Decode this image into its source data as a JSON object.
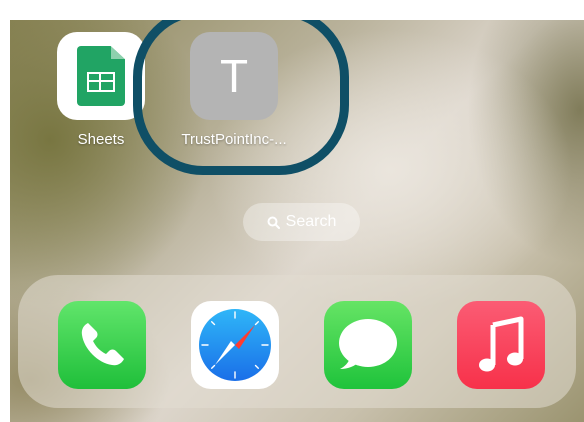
{
  "home_screen": {
    "apps": [
      {
        "label": "Sheets",
        "icon": "google-sheets-icon",
        "color": "#21a464"
      },
      {
        "label": "TrustPointInc-...",
        "icon_letter": "T",
        "icon": "letter-t-icon",
        "color": "#b4b4b4"
      }
    ],
    "highlight_color": "#0f4f66",
    "search": {
      "label": "Search",
      "icon": "search-icon"
    }
  },
  "dock": {
    "apps": [
      {
        "name": "Phone",
        "icon": "phone-icon",
        "color": "#2ac845"
      },
      {
        "name": "Safari",
        "icon": "safari-compass-icon",
        "color": "#1e88f5"
      },
      {
        "name": "Messages",
        "icon": "messages-icon",
        "color": "#2ac845"
      },
      {
        "name": "Music",
        "icon": "music-note-icon",
        "color": "#f7314a"
      }
    ]
  }
}
